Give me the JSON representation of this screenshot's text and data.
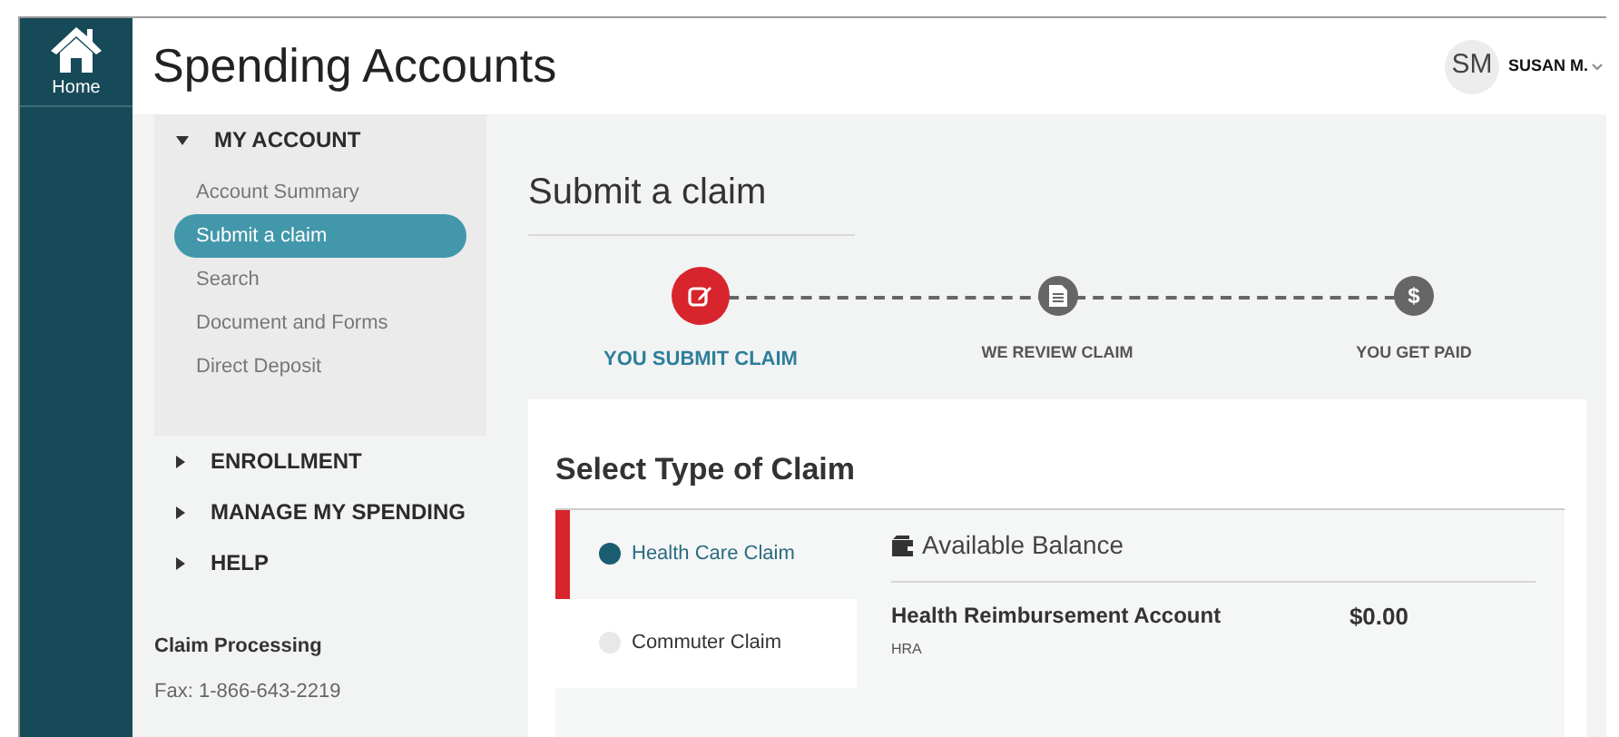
{
  "rail": {
    "home_label": "Home"
  },
  "header": {
    "title": "Spending Accounts",
    "user_initials": "SM",
    "user_name": "SUSAN M."
  },
  "sidebar": {
    "sections": [
      {
        "label": "MY ACCOUNT",
        "expanded": true,
        "items": [
          {
            "label": "Account Summary",
            "selected": false
          },
          {
            "label": "Submit a claim",
            "selected": true
          },
          {
            "label": "Search",
            "selected": false
          },
          {
            "label": "Document and Forms",
            "selected": false
          },
          {
            "label": "Direct Deposit",
            "selected": false
          }
        ]
      },
      {
        "label": "ENROLLMENT",
        "expanded": false
      },
      {
        "label": "MANAGE MY SPENDING",
        "expanded": false
      },
      {
        "label": "HELP",
        "expanded": false
      }
    ],
    "contact": {
      "title": "Claim Processing",
      "fax": "Fax: 1-866-643-2219"
    }
  },
  "page_title": "Submit a claim",
  "steps": [
    {
      "label": "YOU SUBMIT CLAIM",
      "kind": "edit",
      "selected": true
    },
    {
      "label": "WE REVIEW CLAIM",
      "kind": "document",
      "selected": false
    },
    {
      "label": "YOU GET PAID",
      "kind": "dollar",
      "icon": "$",
      "selected": false
    }
  ],
  "claim_section": {
    "title": "Select Type of Claim",
    "claim_types": [
      {
        "label": "Health Care Claim",
        "selected": true
      },
      {
        "label": "Commuter Claim",
        "selected": false
      }
    ],
    "balance": {
      "title": "Available Balance",
      "accounts": [
        {
          "name": "Health Reimbursement Account",
          "code": "HRA",
          "amount": "$0.00"
        }
      ]
    }
  }
}
